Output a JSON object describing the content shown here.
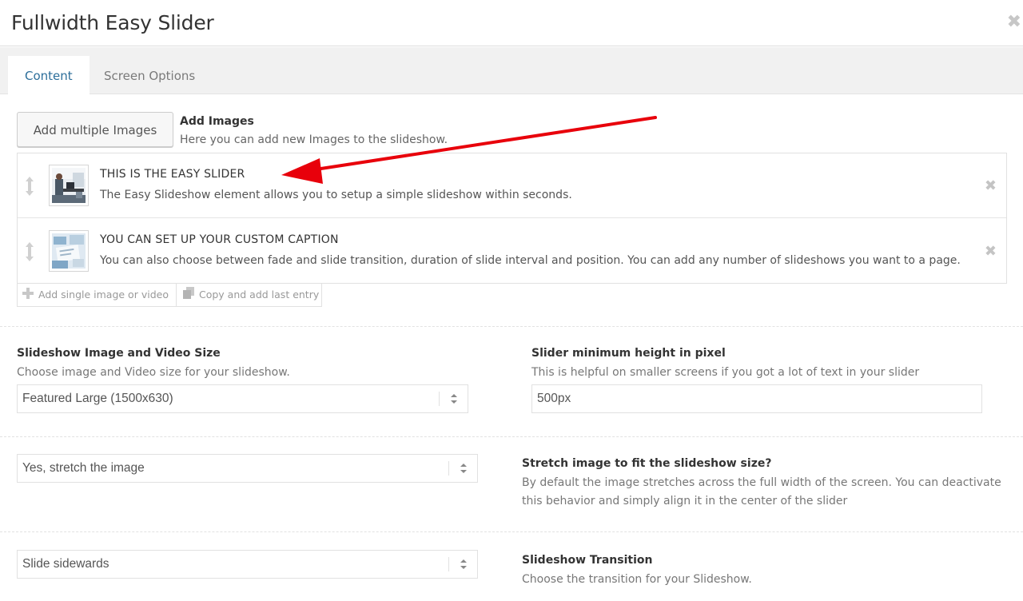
{
  "modal": {
    "title": "Fullwidth Easy Slider",
    "close_symbol": "✖"
  },
  "tabs": [
    {
      "label": "Content",
      "active": true
    },
    {
      "label": "Screen Options",
      "active": false
    }
  ],
  "add_images": {
    "button_label": "Add multiple Images",
    "title": "Add Images",
    "description": "Here you can add new Images to the slideshow."
  },
  "slides": [
    {
      "title": "THIS IS THE EASY SLIDER",
      "description": "The Easy Slideshow element allows you to setup a simple slideshow within seconds.",
      "thumb_icon": "office-photo-icon",
      "remove_symbol": "✖"
    },
    {
      "title": "YOU CAN SET UP YOUR CUSTOM CAPTION",
      "description": "You can also choose between fade and slide transition, duration of slide interval and position. You can add any number of slideshows you want to a page.",
      "thumb_icon": "desk-photo-icon",
      "remove_symbol": "✖"
    }
  ],
  "entry_buttons": {
    "add_single": "Add single image or video",
    "copy_last": "Copy and add last entry"
  },
  "settings": {
    "image_size": {
      "label": "Slideshow Image and Video Size",
      "help": "Choose image and Video size for your slideshow.",
      "value": "Featured Large (1500x630)"
    },
    "min_height": {
      "label": "Slider minimum height in pixel",
      "help": "This is helpful on smaller screens if you got a lot of text in your slider",
      "value": "500px"
    },
    "stretch": {
      "label": "Stretch image to fit the slideshow size?",
      "help_line1": "By default the image stretches across the full width of the screen. You can deactivate",
      "help_line2": "this behavior and simply align it in the center of the slider",
      "value": "Yes, stretch the image"
    },
    "transition": {
      "label": "Slideshow Transition",
      "help": "Choose the transition for your Slideshow.",
      "value": "Slide sidewards"
    }
  },
  "colors": {
    "annotation_arrow": "#e8000b",
    "active_tab_text": "#2c6e9a"
  }
}
